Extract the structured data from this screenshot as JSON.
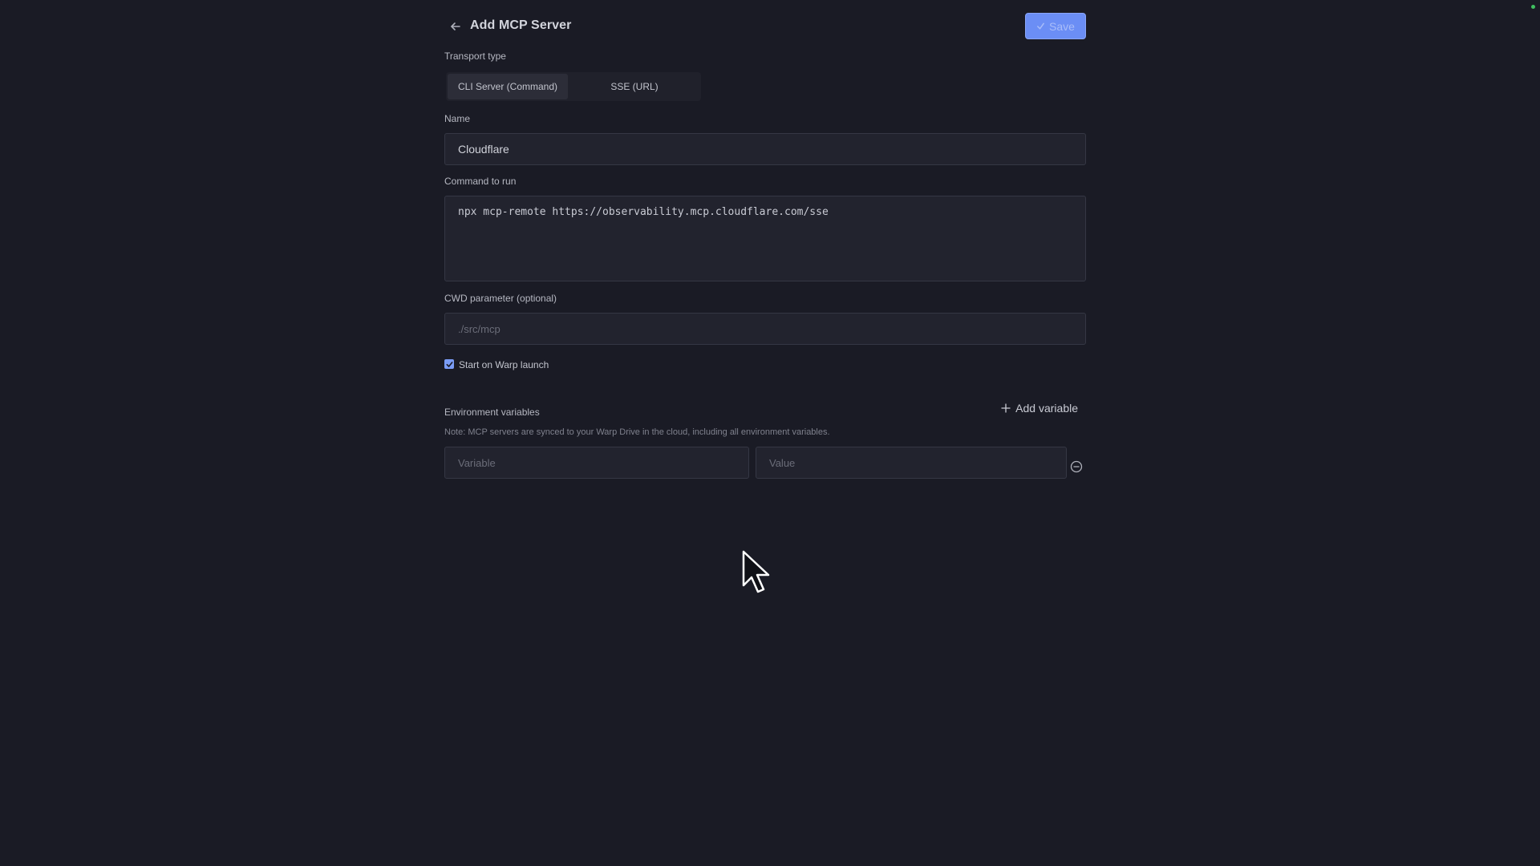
{
  "header": {
    "title": "Add MCP Server",
    "save_label": "Save"
  },
  "transport": {
    "label": "Transport type",
    "options": [
      "CLI Server (Command)",
      "SSE (URL)"
    ],
    "selected": "CLI Server (Command)"
  },
  "name": {
    "label": "Name",
    "value": "Cloudflare"
  },
  "command": {
    "label": "Command to run",
    "value": "npx mcp-remote https://observability.mcp.cloudflare.com/sse"
  },
  "cwd": {
    "label": "CWD parameter (optional)",
    "placeholder": "./src/mcp"
  },
  "start_on_launch": {
    "label": "Start on Warp launch",
    "checked": true
  },
  "env": {
    "label": "Environment variables",
    "add_label": "Add variable",
    "note": "Note: MCP servers are synced to your Warp Drive in the cloud, including all environment variables.",
    "variable_placeholder": "Variable",
    "value_placeholder": "Value"
  },
  "colors": {
    "background": "#1a1b25",
    "accent": "#6b8ef5",
    "field_bg": "#22232e"
  }
}
